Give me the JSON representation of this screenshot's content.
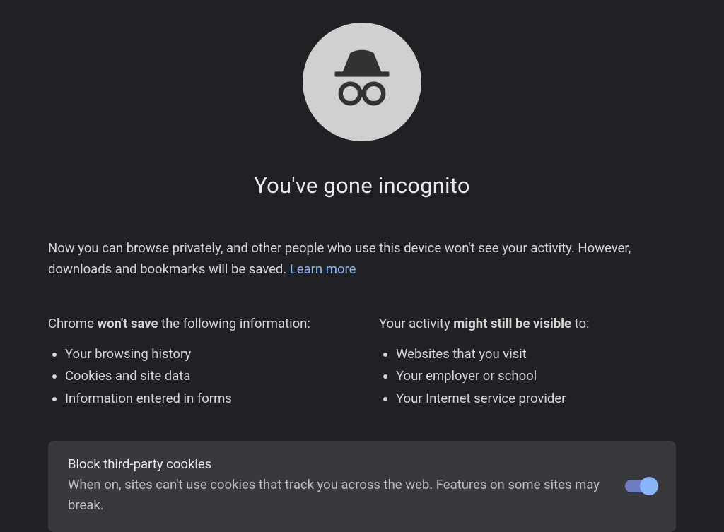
{
  "heading": "You've gone incognito",
  "intro": {
    "part1": "Now you can browse privately, and other people who use this device won't see your activity. However, downloads and bookmarks will be saved. ",
    "learn_more": "Learn more"
  },
  "columns": {
    "left": {
      "heading_prefix": "Chrome ",
      "heading_bold": "won't save",
      "heading_suffix": " the following information:",
      "items": [
        "Your browsing history",
        "Cookies and site data",
        "Information entered in forms"
      ]
    },
    "right": {
      "heading_prefix": "Your activity ",
      "heading_bold": "might still be visible",
      "heading_suffix": " to:",
      "items": [
        "Websites that you visit",
        "Your employer or school",
        "Your Internet service provider"
      ]
    }
  },
  "cookie_box": {
    "title": "Block third-party cookies",
    "description": "When on, sites can't use cookies that track you across the web. Features on some sites may break.",
    "toggle_on": true
  },
  "icon_name": "incognito-icon"
}
